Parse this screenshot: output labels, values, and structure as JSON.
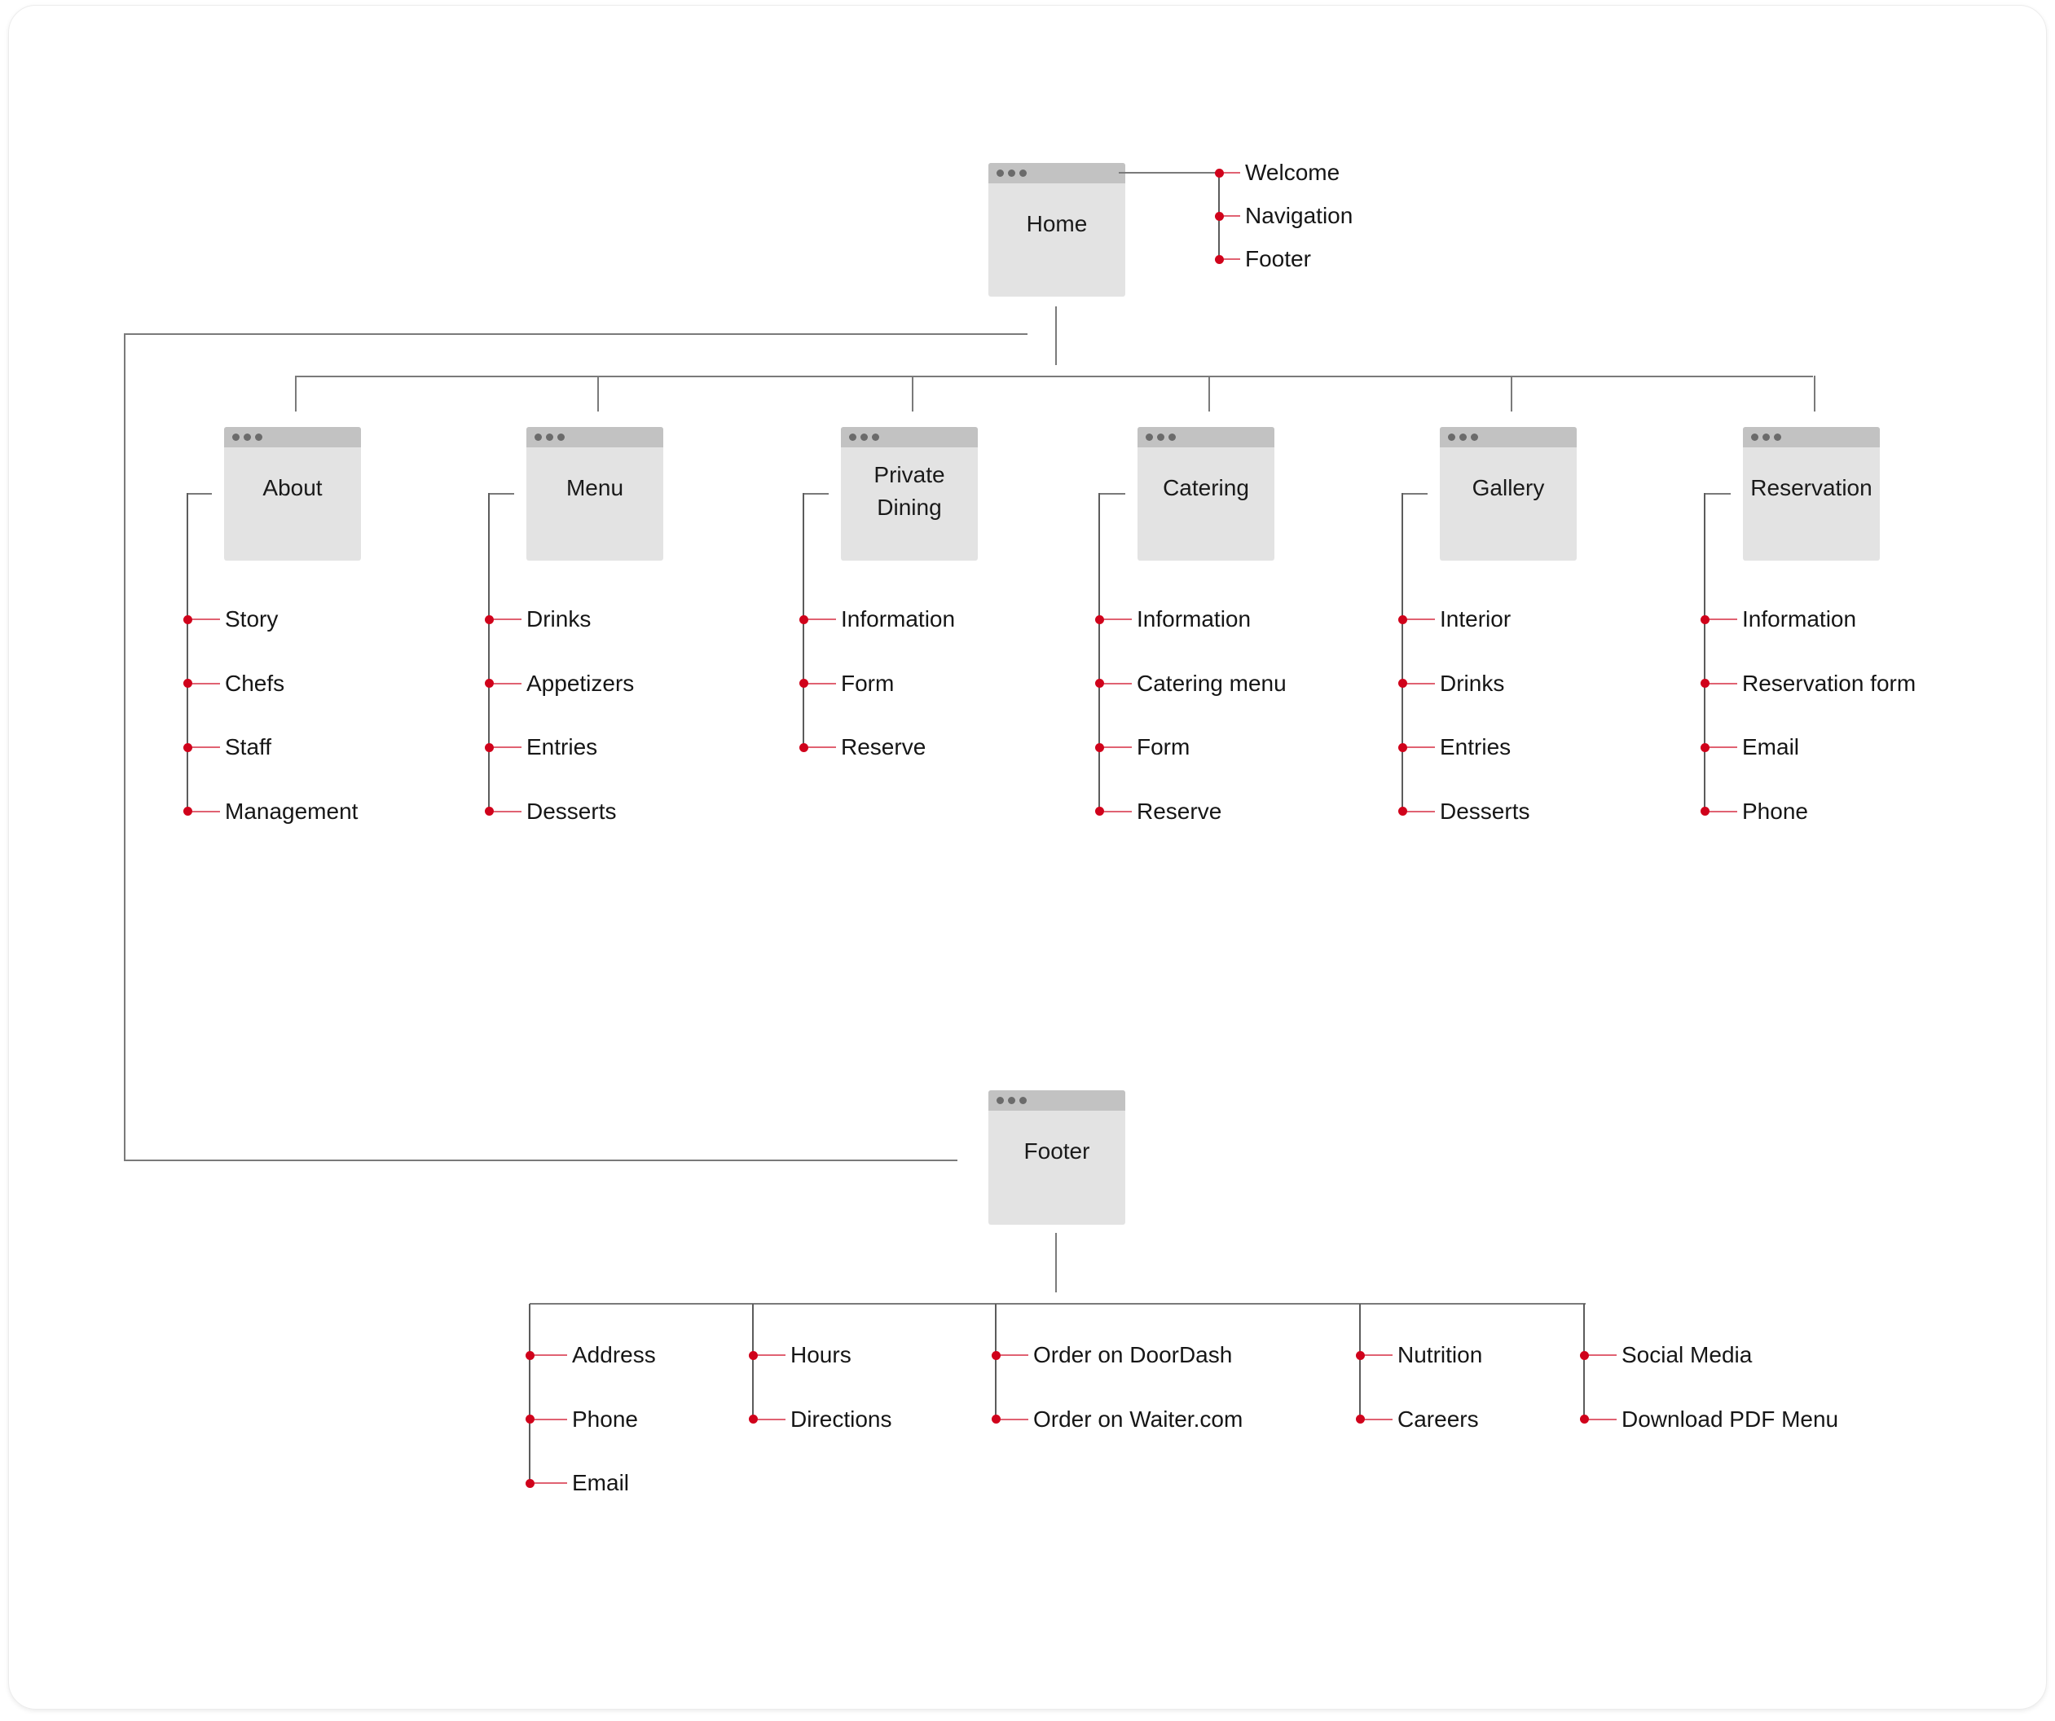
{
  "diagram": {
    "type": "sitemap",
    "accent_color": "#d0021b",
    "connector_color": "#7a7a7a",
    "page_box_color": "#e3e3e3",
    "page_bar_color": "#c2c2c2",
    "home": {
      "label": "Home",
      "sections": [
        "Welcome",
        "Navigation",
        "Footer"
      ]
    },
    "pages": [
      {
        "label": "About",
        "items": [
          "Story",
          "Chefs",
          "Staff",
          "Management"
        ]
      },
      {
        "label": "Menu",
        "items": [
          "Drinks",
          "Appetizers",
          "Entries",
          "Desserts"
        ]
      },
      {
        "label": "Private Dining",
        "label_lines": [
          "Private",
          "Dining"
        ],
        "items": [
          "Information",
          "Form",
          "Reserve"
        ]
      },
      {
        "label": "Catering",
        "items": [
          "Information",
          "Catering menu",
          "Form",
          "Reserve"
        ]
      },
      {
        "label": "Gallery",
        "items": [
          "Interior",
          "Drinks",
          "Entries",
          "Desserts"
        ]
      },
      {
        "label": "Reservation",
        "items": [
          "Information",
          "Reservation form",
          "Email",
          "Phone"
        ]
      }
    ],
    "footer": {
      "label": "Footer",
      "groups": [
        [
          "Address",
          "Phone",
          "Email"
        ],
        [
          "Hours",
          "Directions"
        ],
        [
          "Order on DoorDash",
          "Order on Waiter.com"
        ],
        [
          "Nutrition",
          "Careers"
        ],
        [
          "Social Media",
          "Download PDF Menu"
        ]
      ]
    }
  }
}
